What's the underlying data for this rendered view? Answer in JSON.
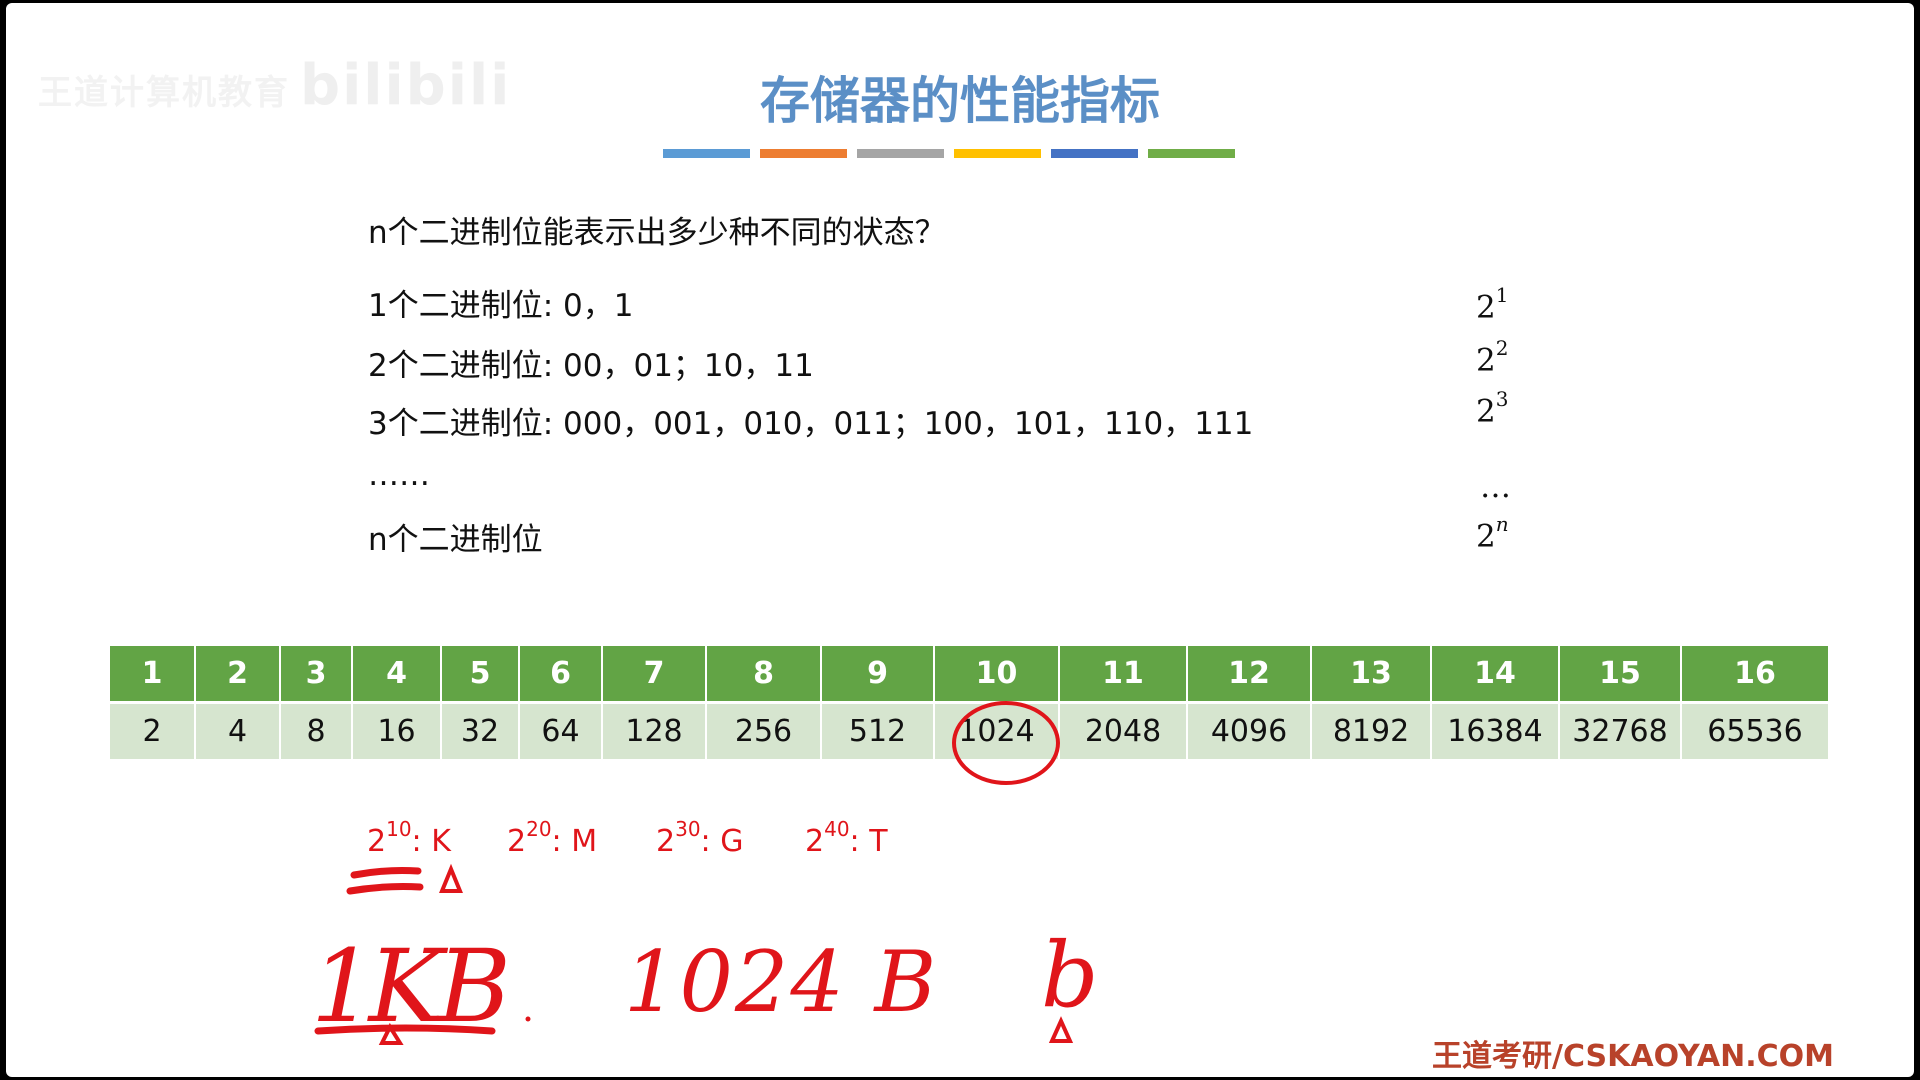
{
  "watermark": {
    "text": "王道计算机教育",
    "logo": "bilibili"
  },
  "title": "存储器的性能指标",
  "colorbar": [
    "#5b9bd5",
    "#ed7d31",
    "#a5a5a5",
    "#ffc000",
    "#4472c4",
    "#70ad47"
  ],
  "question": "n个二进制位能表示出多少种不同的状态？",
  "lines": [
    "1个二进制位: 0，1",
    "2个二进制位: 00，01；10，11",
    "3个二进制位: 000，001，010，011；100，101，110，111",
    "……",
    "n个二进制位"
  ],
  "powers": [
    {
      "base": "2",
      "exp": "1"
    },
    {
      "base": "2",
      "exp": "2"
    },
    {
      "base": "2",
      "exp": "3"
    },
    {
      "base": "…",
      "exp": ""
    },
    {
      "base": "2",
      "exp": "n"
    }
  ],
  "table": {
    "header": [
      "1",
      "2",
      "3",
      "4",
      "5",
      "6",
      "7",
      "8",
      "9",
      "10",
      "11",
      "12",
      "13",
      "14",
      "15",
      "16"
    ],
    "values": [
      "2",
      "4",
      "8",
      "16",
      "32",
      "64",
      "128",
      "256",
      "512",
      "1024",
      "2048",
      "4096",
      "8192",
      "16384",
      "32768",
      "65536"
    ]
  },
  "annotations": [
    {
      "base": "2",
      "exp": "10",
      "unit": ": K"
    },
    {
      "base": "2",
      "exp": "20",
      "unit": ": M"
    },
    {
      "base": "2",
      "exp": "30",
      "unit": ": G"
    },
    {
      "base": "2",
      "exp": "40",
      "unit": ": T"
    }
  ],
  "handwriting": {
    "kb": "1KB",
    "bytes": "1024 B",
    "b": "b"
  },
  "footer": "王道考研/CSKAOYAN.COM",
  "accent_color": "#e0151a",
  "table_header_color": "#62a445",
  "table_value_color": "#d6e5cf",
  "title_color": "#5b8fc6"
}
